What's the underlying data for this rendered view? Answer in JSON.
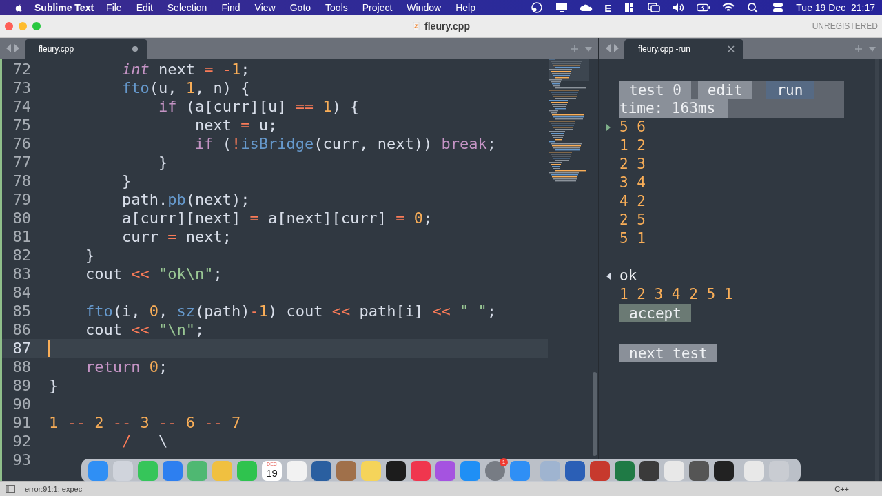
{
  "menubar": {
    "app": "Sublime Text",
    "menus": [
      "File",
      "Edit",
      "Selection",
      "Find",
      "View",
      "Goto",
      "Tools",
      "Project",
      "Window",
      "Help"
    ],
    "status_letter": "E",
    "date": "Tue 19 Dec",
    "time": "21:17"
  },
  "window": {
    "title": "fleury.cpp",
    "license": "UNREGISTERED"
  },
  "left_tab": {
    "label": "fleury.cpp",
    "modified": true
  },
  "right_tab": {
    "label": "fleury.cpp -run",
    "modified": false
  },
  "editor": {
    "lines": [
      {
        "number": "72",
        "current": false,
        "tokens": [
          {
            "kind": "type",
            "text": "        int"
          },
          {
            "kind": "plain",
            "text": " next "
          },
          {
            "kind": "op",
            "text": "= -"
          },
          {
            "kind": "num",
            "text": "1"
          },
          {
            "kind": "plain",
            "text": ";"
          }
        ]
      },
      {
        "number": "73",
        "current": false,
        "tokens": [
          {
            "kind": "fn",
            "text": "        fto"
          },
          {
            "kind": "plain",
            "text": "(u, "
          },
          {
            "kind": "num",
            "text": "1"
          },
          {
            "kind": "plain",
            "text": ", n) {"
          }
        ]
      },
      {
        "number": "74",
        "current": false,
        "tokens": [
          {
            "kind": "kw",
            "text": "            if"
          },
          {
            "kind": "plain",
            "text": " (a[curr][u] "
          },
          {
            "kind": "op",
            "text": "=="
          },
          {
            "kind": "num",
            "text": " 1"
          },
          {
            "kind": "plain",
            "text": ") {"
          }
        ]
      },
      {
        "number": "75",
        "current": false,
        "tokens": [
          {
            "kind": "plain",
            "text": "                next "
          },
          {
            "kind": "op",
            "text": "="
          },
          {
            "kind": "plain",
            "text": " u;"
          }
        ]
      },
      {
        "number": "76",
        "current": false,
        "tokens": [
          {
            "kind": "kw",
            "text": "                if"
          },
          {
            "kind": "plain",
            "text": " ("
          },
          {
            "kind": "op",
            "text": "!"
          },
          {
            "kind": "fn",
            "text": "isBridge"
          },
          {
            "kind": "plain",
            "text": "(curr, next)) "
          },
          {
            "kind": "kw",
            "text": "break"
          },
          {
            "kind": "plain",
            "text": ";"
          }
        ]
      },
      {
        "number": "77",
        "current": false,
        "tokens": [
          {
            "kind": "plain",
            "text": "            }"
          }
        ]
      },
      {
        "number": "78",
        "current": false,
        "tokens": [
          {
            "kind": "plain",
            "text": "        }"
          }
        ]
      },
      {
        "number": "79",
        "current": false,
        "tokens": [
          {
            "kind": "plain",
            "text": "        path."
          },
          {
            "kind": "fn",
            "text": "pb"
          },
          {
            "kind": "plain",
            "text": "(next);"
          }
        ]
      },
      {
        "number": "80",
        "current": false,
        "tokens": [
          {
            "kind": "plain",
            "text": "        a[curr][next] "
          },
          {
            "kind": "op",
            "text": "="
          },
          {
            "kind": "plain",
            "text": " a[next][curr] "
          },
          {
            "kind": "op",
            "text": "="
          },
          {
            "kind": "num",
            "text": " 0"
          },
          {
            "kind": "plain",
            "text": ";"
          }
        ]
      },
      {
        "number": "81",
        "current": false,
        "tokens": [
          {
            "kind": "plain",
            "text": "        curr "
          },
          {
            "kind": "op",
            "text": "="
          },
          {
            "kind": "plain",
            "text": " next;"
          }
        ]
      },
      {
        "number": "82",
        "current": false,
        "tokens": [
          {
            "kind": "plain",
            "text": "    }"
          }
        ]
      },
      {
        "number": "83",
        "current": false,
        "tokens": [
          {
            "kind": "plain",
            "text": "    cout "
          },
          {
            "kind": "op",
            "text": "<<"
          },
          {
            "kind": "str",
            "text": " \"ok\\n\""
          },
          {
            "kind": "plain",
            "text": ";"
          }
        ]
      },
      {
        "number": "84",
        "current": false
      },
      {
        "number": "85",
        "current": false,
        "tokens": [
          {
            "kind": "fn",
            "text": "    fto"
          },
          {
            "kind": "plain",
            "text": "(i, "
          },
          {
            "kind": "num",
            "text": "0"
          },
          {
            "kind": "plain",
            "text": ", "
          },
          {
            "kind": "fn",
            "text": "sz"
          },
          {
            "kind": "plain",
            "text": "(path)"
          },
          {
            "kind": "op",
            "text": "-"
          },
          {
            "kind": "num",
            "text": "1"
          },
          {
            "kind": "plain",
            "text": ") cout "
          },
          {
            "kind": "op",
            "text": "<<"
          },
          {
            "kind": "plain",
            "text": " path[i] "
          },
          {
            "kind": "op",
            "text": "<<"
          },
          {
            "kind": "str",
            "text": " \" \""
          },
          {
            "kind": "plain",
            "text": ";"
          }
        ]
      },
      {
        "number": "86",
        "current": false,
        "tokens": [
          {
            "kind": "plain",
            "text": "    cout "
          },
          {
            "kind": "op",
            "text": "<<"
          },
          {
            "kind": "str",
            "text": " \"\\n\""
          },
          {
            "kind": "plain",
            "text": ";"
          }
        ]
      },
      {
        "number": "87",
        "current": true
      },
      {
        "number": "88",
        "current": false,
        "tokens": [
          {
            "kind": "kw",
            "text": "    return"
          },
          {
            "kind": "num",
            "text": " 0"
          },
          {
            "kind": "plain",
            "text": ";"
          }
        ]
      },
      {
        "number": "89",
        "current": false,
        "tokens": [
          {
            "kind": "plain",
            "text": "}"
          }
        ]
      },
      {
        "number": "90",
        "current": false
      },
      {
        "number": "91",
        "current": false,
        "tokens": [
          {
            "kind": "num",
            "text": "1"
          },
          {
            "kind": "op",
            "text": " --"
          },
          {
            "kind": "num",
            "text": " 2"
          },
          {
            "kind": "op",
            "text": " --"
          },
          {
            "kind": "num",
            "text": " 3"
          },
          {
            "kind": "op",
            "text": " --"
          },
          {
            "kind": "num",
            "text": " 6"
          },
          {
            "kind": "op",
            "text": " --"
          },
          {
            "kind": "num",
            "text": " 7"
          }
        ]
      },
      {
        "number": "92",
        "current": false,
        "tokens": [
          {
            "kind": "op",
            "text": "        /"
          },
          {
            "kind": "plain",
            "text": "   \\"
          }
        ]
      },
      {
        "number": "93",
        "current": false
      }
    ]
  },
  "runner": {
    "controls": [
      {
        "label": "test 0",
        "kind": "label"
      },
      {
        "label": "edit",
        "kind": "button"
      },
      {
        "label": "run",
        "kind": "run"
      }
    ],
    "time": "time: 163ms",
    "input": [
      "5 6",
      "1 2",
      "2 3",
      "3 4",
      "4 2",
      "2 5",
      "5 1"
    ],
    "verdict": "ok",
    "output": "1 2 3 4 2 5 1",
    "accept": "accept",
    "next": "next test"
  },
  "dock": {
    "calendar_month": "DEC",
    "calendar_day": "19",
    "badge": "1"
  },
  "status_bar": {
    "message": "error:91:1: expec",
    "syntax": "C++"
  }
}
